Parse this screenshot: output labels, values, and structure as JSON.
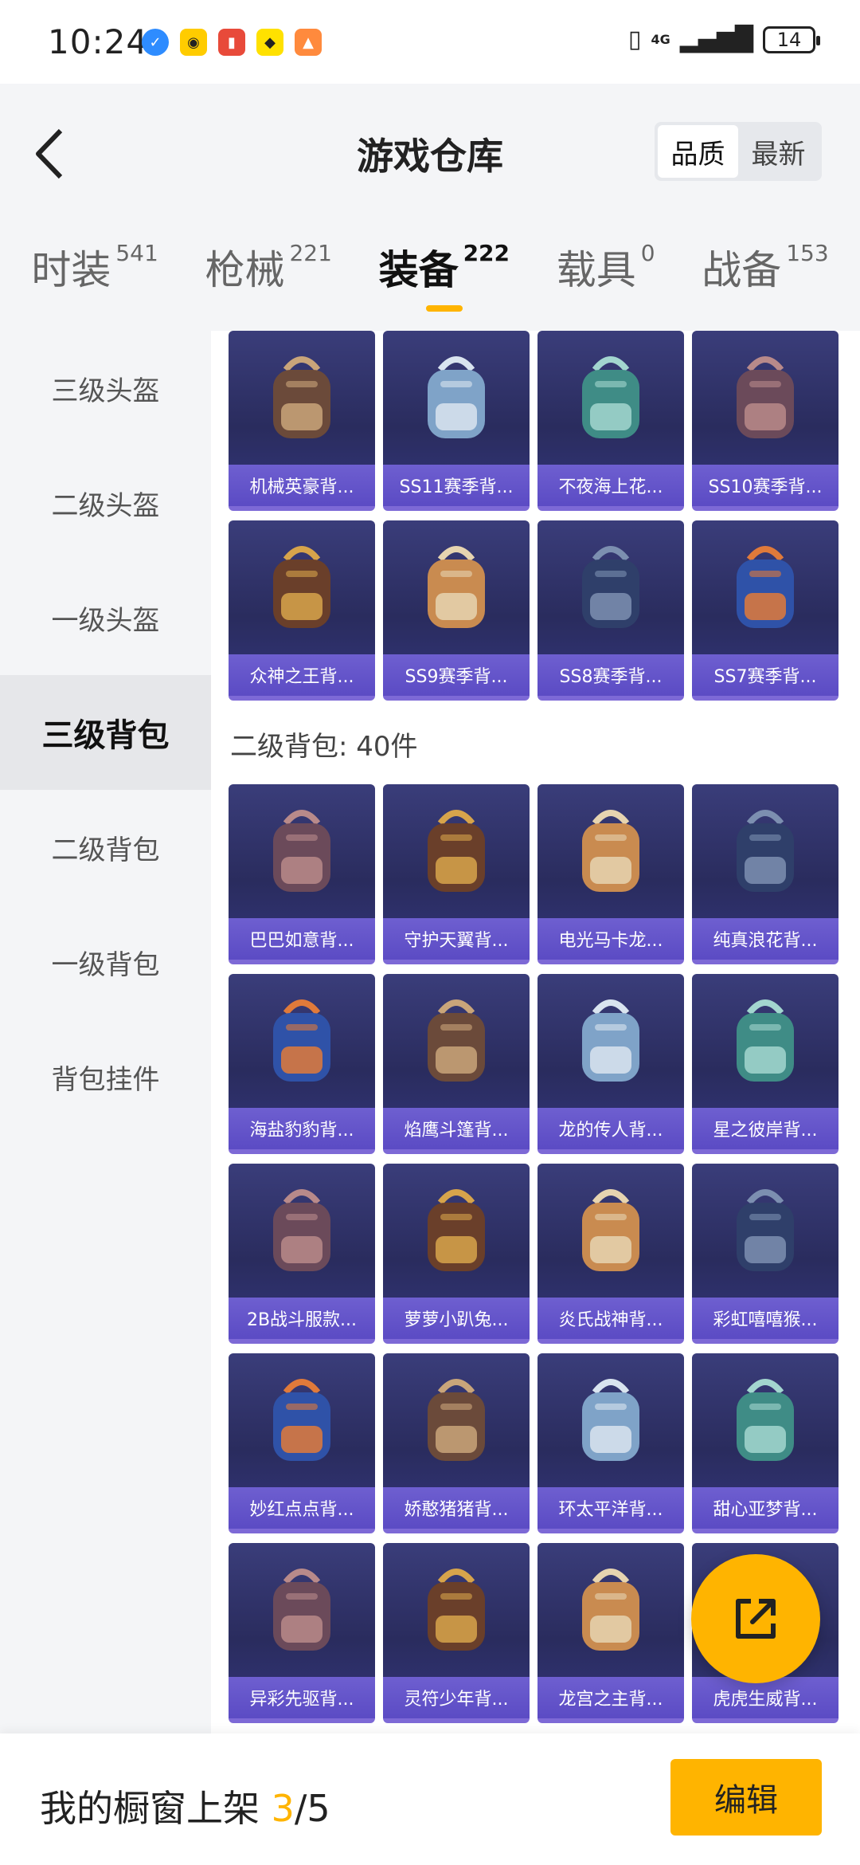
{
  "status_bar": {
    "time": "10:24",
    "network": "4G",
    "battery": "14"
  },
  "header": {
    "title": "游戏仓库",
    "sort_options": [
      "品质",
      "最新"
    ],
    "active_sort": "品质"
  },
  "tabs": [
    {
      "label": "时装",
      "count": "541"
    },
    {
      "label": "枪械",
      "count": "221"
    },
    {
      "label": "装备",
      "count": "222"
    },
    {
      "label": "载具",
      "count": "0"
    },
    {
      "label": "战备",
      "count": "153"
    }
  ],
  "active_tab": "装备",
  "sidebar": [
    "三级头盔",
    "二级头盔",
    "一级头盔",
    "三级背包",
    "二级背包",
    "一级背包",
    "背包挂件"
  ],
  "active_sidebar": "三级背包",
  "level3_items": [
    "机械英豪背...",
    "SS11赛季背...",
    "不夜海上花...",
    "SS10赛季背...",
    "众神之王背...",
    "SS9赛季背...",
    "SS8赛季背...",
    "SS7赛季背..."
  ],
  "level2_section": {
    "title": "二级背包: 40件"
  },
  "level2_items": [
    "巴巴如意背...",
    "守护天翼背...",
    "电光马卡龙...",
    "纯真浪花背...",
    "海盐豹豹背...",
    "焰鹰斗篷背...",
    "龙的传人背...",
    "星之彼岸背...",
    "2B战斗服款...",
    "萝萝小趴兔...",
    "炎氏战神背...",
    "彩虹嘻嘻猴...",
    "妙红点点背...",
    "娇憨猪猪背...",
    "环太平洋背...",
    "甜心亚梦背...",
    "异彩先驱背...",
    "灵符少年背...",
    "龙宫之主背...",
    "虎虎生威背..."
  ],
  "bottom_bar": {
    "label": "我的橱窗上架",
    "current": "3",
    "total": "/5",
    "edit_label": "编辑"
  },
  "colors": {
    "accent": "#ffb400",
    "card_bg": "#2f316a",
    "card_label": "#6455c8"
  }
}
